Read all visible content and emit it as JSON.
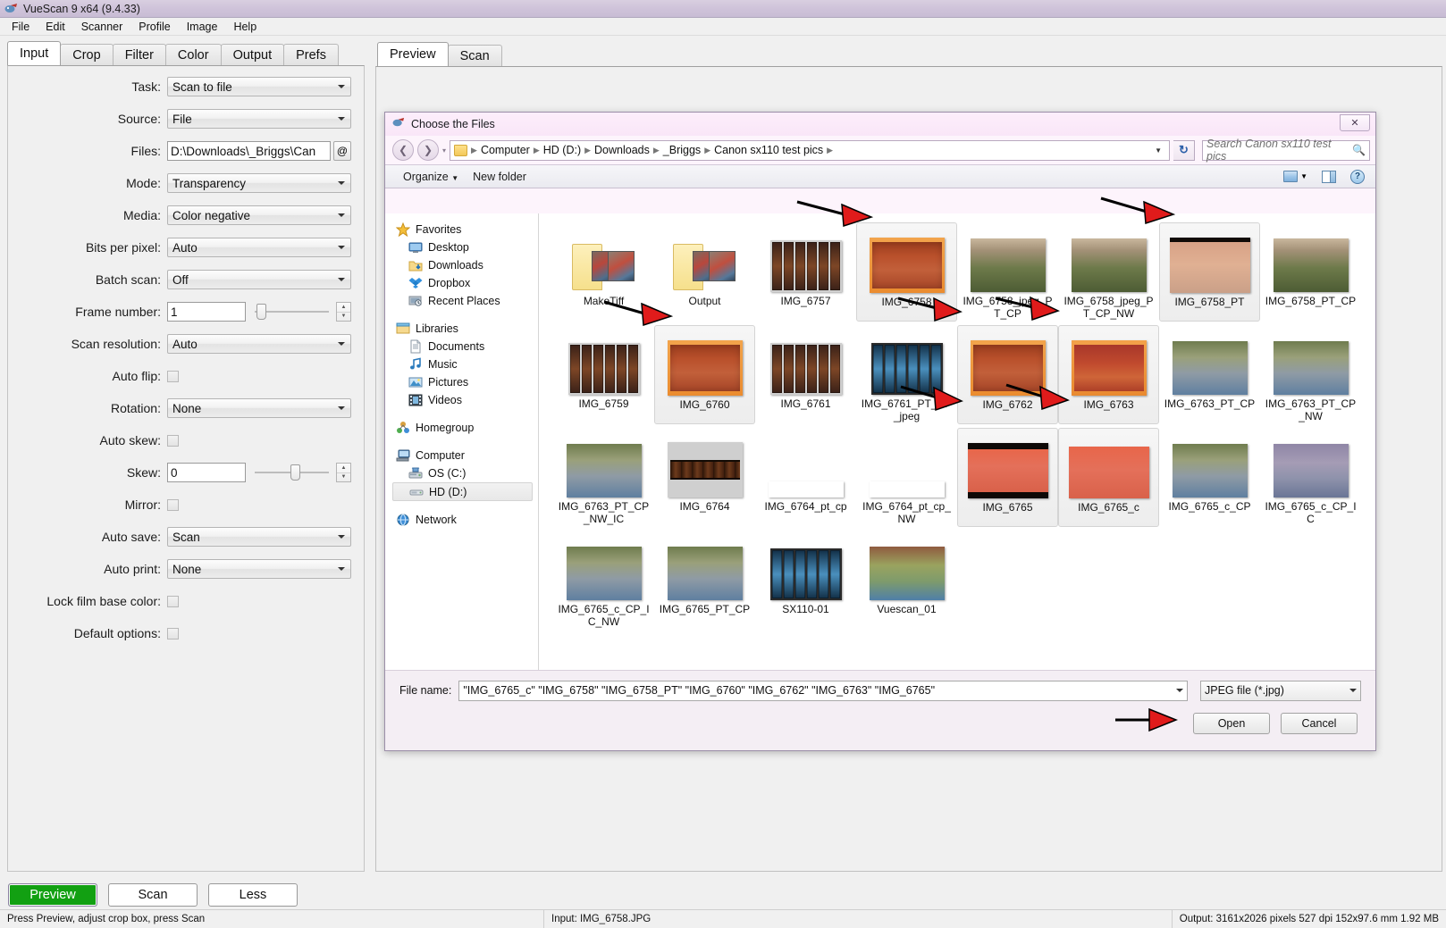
{
  "window": {
    "title": "VueScan 9 x64 (9.4.33)",
    "icon": "vuescan-icon"
  },
  "menubar": [
    "File",
    "Edit",
    "Scanner",
    "Profile",
    "Image",
    "Help"
  ],
  "left_tabs": [
    {
      "label": "Input",
      "active": true
    },
    {
      "label": "Crop",
      "active": false
    },
    {
      "label": "Filter",
      "active": false
    },
    {
      "label": "Color",
      "active": false
    },
    {
      "label": "Output",
      "active": false
    },
    {
      "label": "Prefs",
      "active": false
    }
  ],
  "input_form": [
    {
      "label": "Task:",
      "type": "combo",
      "value": "Scan to file"
    },
    {
      "label": "Source:",
      "type": "combo",
      "value": "File"
    },
    {
      "label": "Files:",
      "type": "text-at",
      "value": "D:\\Downloads\\_Briggs\\Can",
      "button": "@"
    },
    {
      "label": "Mode:",
      "type": "combo",
      "value": "Transparency"
    },
    {
      "label": "Media:",
      "type": "combo",
      "value": "Color negative"
    },
    {
      "label": "Bits per pixel:",
      "type": "combo",
      "value": "Auto"
    },
    {
      "label": "Batch scan:",
      "type": "combo",
      "value": "Off"
    },
    {
      "label": "Frame number:",
      "type": "spin",
      "value": "1",
      "slider_pct": 2
    },
    {
      "label": "Scan resolution:",
      "type": "combo",
      "value": "Auto"
    },
    {
      "label": "Auto flip:",
      "type": "check",
      "value": false
    },
    {
      "label": "Rotation:",
      "type": "combo",
      "value": "None"
    },
    {
      "label": "Auto skew:",
      "type": "check",
      "value": false
    },
    {
      "label": "Skew:",
      "type": "spin",
      "value": "0",
      "slider_pct": 50
    },
    {
      "label": "Mirror:",
      "type": "check",
      "value": false
    },
    {
      "label": "Auto save:",
      "type": "combo",
      "value": "Scan"
    },
    {
      "label": "Auto print:",
      "type": "combo",
      "value": "None"
    },
    {
      "label": "Lock film base color:",
      "type": "check",
      "value": false
    },
    {
      "label": "Default options:",
      "type": "check",
      "value": false
    }
  ],
  "preview_tabs": [
    {
      "label": "Preview",
      "active": true
    },
    {
      "label": "Scan",
      "active": false
    }
  ],
  "dialog": {
    "title": "Choose the Files",
    "close_label": "✕",
    "back_icon": "back-arrow-icon",
    "forward_icon": "forward-arrow-icon",
    "breadcrumb": [
      "Computer",
      "HD (D:)",
      "Downloads",
      "_Briggs",
      "Canon sx110 test pics"
    ],
    "refresh_icon": "refresh-icon",
    "search_placeholder": "Search Canon sx110 test pics",
    "toolbar": {
      "organize": "Organize",
      "new_folder": "New folder",
      "view_icon": "view-mode-icon",
      "pane_icon": "preview-pane-icon",
      "help_icon": "help-icon"
    },
    "sidebar": [
      {
        "label": "Favorites",
        "icon": "star-icon",
        "level": 0
      },
      {
        "label": "Desktop",
        "icon": "desktop-icon",
        "level": 1
      },
      {
        "label": "Downloads",
        "icon": "downloads-icon",
        "level": 1
      },
      {
        "label": "Dropbox",
        "icon": "dropbox-icon",
        "level": 1
      },
      {
        "label": "Recent Places",
        "icon": "recent-places-icon",
        "level": 1
      },
      {
        "label": "",
        "icon": "gap",
        "level": 0
      },
      {
        "label": "Libraries",
        "icon": "libraries-icon",
        "level": 0
      },
      {
        "label": "Documents",
        "icon": "documents-icon",
        "level": 1
      },
      {
        "label": "Music",
        "icon": "music-icon",
        "level": 1
      },
      {
        "label": "Pictures",
        "icon": "pictures-icon",
        "level": 1
      },
      {
        "label": "Videos",
        "icon": "videos-icon",
        "level": 1
      },
      {
        "label": "",
        "icon": "gap",
        "level": 0
      },
      {
        "label": "Homegroup",
        "icon": "homegroup-icon",
        "level": 0
      },
      {
        "label": "",
        "icon": "gap",
        "level": 0
      },
      {
        "label": "Computer",
        "icon": "computer-icon",
        "level": 0
      },
      {
        "label": "OS (C:)",
        "icon": "drive-os-icon",
        "level": 1
      },
      {
        "label": "HD (D:)",
        "icon": "drive-hd-icon",
        "level": 1,
        "selected": true
      },
      {
        "label": "",
        "icon": "gap",
        "level": 0
      },
      {
        "label": "Network",
        "icon": "network-icon",
        "level": 0
      }
    ],
    "files": [
      {
        "name": "MakeTiff",
        "kind": "folder",
        "selected": false
      },
      {
        "name": "Output",
        "kind": "folder",
        "selected": false
      },
      {
        "name": "IMG_6757",
        "kind": "filmstrip",
        "selected": false
      },
      {
        "name": "IMG_6758",
        "kind": "negative-orange",
        "selected": true
      },
      {
        "name": "IMG_6758_jpeg_PT_CP",
        "kind": "photo-swing",
        "selected": false
      },
      {
        "name": "IMG_6758_jpeg_PT_CP_NW",
        "kind": "photo-swing",
        "selected": false
      },
      {
        "name": "IMG_6758_PT",
        "kind": "negative-pink",
        "selected": true
      },
      {
        "name": "IMG_6758_PT_CP",
        "kind": "photo-swing",
        "selected": false
      },
      {
        "name": "IMG_6759",
        "kind": "filmstrip",
        "selected": false
      },
      {
        "name": "IMG_6760",
        "kind": "negative-orange",
        "selected": true
      },
      {
        "name": "IMG_6761",
        "kind": "filmstrip",
        "selected": false
      },
      {
        "name": "IMG_6761_PT_CP_jpeg",
        "kind": "filmstrip-blue",
        "selected": false
      },
      {
        "name": "IMG_6762",
        "kind": "negative-orange",
        "selected": true
      },
      {
        "name": "IMG_6763",
        "kind": "negative-red",
        "selected": true
      },
      {
        "name": "IMG_6763_PT_CP",
        "kind": "photo-kids",
        "selected": false
      },
      {
        "name": "IMG_6763_PT_CP_NW",
        "kind": "photo-kids",
        "selected": false
      },
      {
        "name": "IMG_6763_PT_CP_NW_IC",
        "kind": "photo-kids",
        "selected": false
      },
      {
        "name": "IMG_6764",
        "kind": "film-horizontal",
        "selected": false
      },
      {
        "name": "IMG_6764_pt_cp",
        "kind": "film-teal",
        "selected": false
      },
      {
        "name": "IMG_6764_pt_cp_NW",
        "kind": "film-teal",
        "selected": false
      },
      {
        "name": "IMG_6765",
        "kind": "negative-salmon",
        "selected": true
      },
      {
        "name": "IMG_6765_c",
        "kind": "negative-salmon2",
        "selected": true
      },
      {
        "name": "IMG_6765_c_CP",
        "kind": "photo-kids",
        "selected": false
      },
      {
        "name": "IMG_6765_c_CP_IC",
        "kind": "photo-kids-cool",
        "selected": false
      },
      {
        "name": "IMG_6765_c_CP_IC_NW",
        "kind": "photo-kids",
        "selected": false
      },
      {
        "name": "IMG_6765_PT_CP",
        "kind": "photo-kids",
        "selected": false
      },
      {
        "name": "SX110-01",
        "kind": "filmstrip-blue",
        "selected": false
      },
      {
        "name": "Vuescan_01",
        "kind": "photo-kids-warm",
        "selected": false
      }
    ],
    "filename_label": "File name:",
    "filename_value": "\"IMG_6765_c\" \"IMG_6758\" \"IMG_6758_PT\" \"IMG_6760\" \"IMG_6762\" \"IMG_6763\" \"IMG_6765\"",
    "filetype_value": "JPEG file (*.jpg)",
    "open_label": "Open",
    "cancel_label": "Cancel"
  },
  "bottom_buttons": [
    {
      "label": "Preview",
      "primary": true
    },
    {
      "label": "Scan",
      "primary": false
    },
    {
      "label": "Less",
      "primary": false
    }
  ],
  "statusbar": {
    "left": "Press Preview, adjust crop box, press Scan",
    "middle": "Input: IMG_6758.JPG",
    "right": "Output: 3161x2026 pixels 527 dpi 152x97.6 mm 1.92 MB"
  },
  "colors": {
    "accent_green": "#12a012",
    "dialog_pink": "#fdf4fc",
    "annotation_red": "#e01b1b"
  }
}
